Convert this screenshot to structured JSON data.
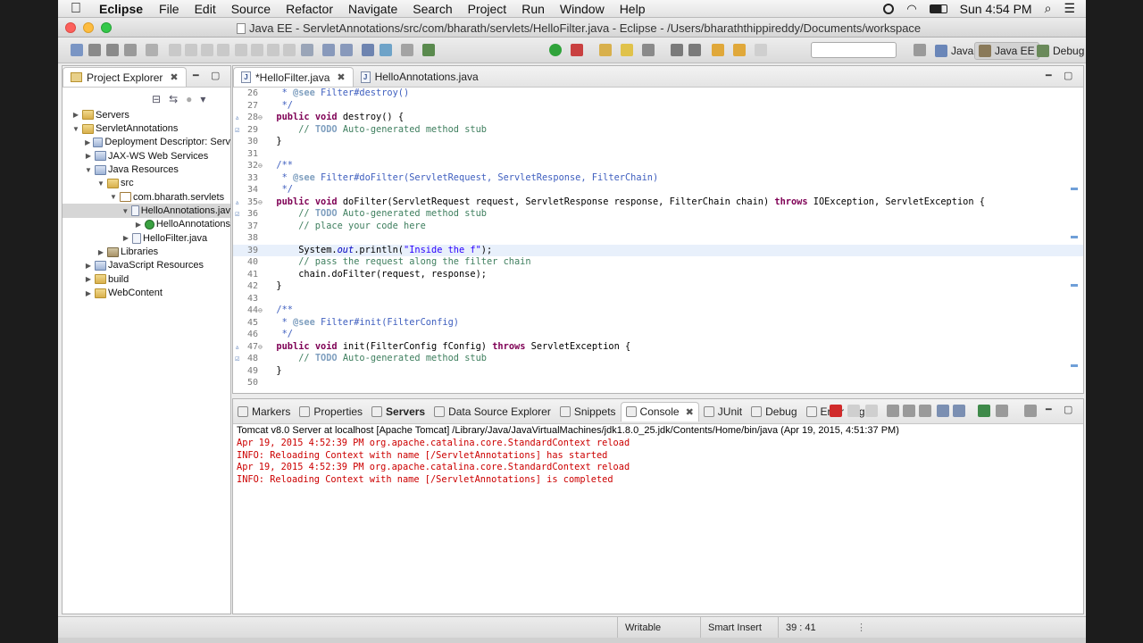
{
  "menubar": {
    "app_name": "Eclipse",
    "items": [
      "File",
      "Edit",
      "Source",
      "Refactor",
      "Navigate",
      "Search",
      "Project",
      "Run",
      "Window",
      "Help"
    ],
    "clock": "Sun 4:54 PM"
  },
  "window": {
    "title": "Java EE - ServletAnnotations/src/com/bharath/servlets/HelloFilter.java - Eclipse - /Users/bharaththippireddy/Documents/workspace"
  },
  "toolbar": {
    "quick_access_placeholder": "",
    "perspectives": [
      {
        "label": "Java",
        "icon": "java-perspective-icon"
      },
      {
        "label": "Java EE",
        "icon": "javaee-perspective-icon"
      },
      {
        "label": "Debug",
        "icon": "debug-perspective-icon"
      }
    ]
  },
  "explorer": {
    "tab_label": "Project Explorer",
    "tree": [
      {
        "label": "Servers",
        "indent": 0,
        "icon": "folder",
        "expanded": false
      },
      {
        "label": "ServletAnnotations",
        "indent": 0,
        "icon": "project",
        "expanded": true
      },
      {
        "label": "Deployment Descriptor: Serv",
        "indent": 1,
        "icon": "gen",
        "expanded": false
      },
      {
        "label": "JAX-WS Web Services",
        "indent": 1,
        "icon": "gen",
        "expanded": false
      },
      {
        "label": "Java Resources",
        "indent": 1,
        "icon": "gen",
        "expanded": true
      },
      {
        "label": "src",
        "indent": 2,
        "icon": "folder",
        "expanded": true
      },
      {
        "label": "com.bharath.servlets",
        "indent": 3,
        "icon": "pkg",
        "expanded": true
      },
      {
        "label": "HelloAnnotations.jav",
        "indent": 4,
        "icon": "java",
        "expanded": true,
        "selected": true
      },
      {
        "label": "HelloAnnotations",
        "indent": 5,
        "icon": "class",
        "expanded": false
      },
      {
        "label": "HelloFilter.java",
        "indent": 4,
        "icon": "java",
        "expanded": false
      },
      {
        "label": "Libraries",
        "indent": 2,
        "icon": "lib",
        "expanded": false
      },
      {
        "label": "JavaScript Resources",
        "indent": 1,
        "icon": "gen",
        "expanded": false
      },
      {
        "label": "build",
        "indent": 1,
        "icon": "folder",
        "expanded": false
      },
      {
        "label": "WebContent",
        "indent": 1,
        "icon": "folder",
        "expanded": false
      }
    ]
  },
  "editor": {
    "tabs": [
      {
        "label": "*HelloFilter.java",
        "active": true
      },
      {
        "label": "HelloAnnotations.java",
        "active": false
      }
    ],
    "lines": [
      {
        "n": "26",
        "text": "   * @see Filter#destroy()",
        "k": "jd"
      },
      {
        "n": "27",
        "text": "   */",
        "k": "jd"
      },
      {
        "n": "28",
        "text": "  public void destroy() {",
        "k": "code",
        "fold": "⊖",
        "mark": "▵"
      },
      {
        "n": "29",
        "text": "      // TODO Auto-generated method stub",
        "k": "cm",
        "mark": "☑"
      },
      {
        "n": "30",
        "text": "  }",
        "k": "code"
      },
      {
        "n": "31",
        "text": "",
        "k": "code"
      },
      {
        "n": "32",
        "text": "  /**",
        "k": "jd",
        "fold": "⊖"
      },
      {
        "n": "33",
        "text": "   * @see Filter#doFilter(ServletRequest, ServletResponse, FilterChain)",
        "k": "jd"
      },
      {
        "n": "34",
        "text": "   */",
        "k": "jd"
      },
      {
        "n": "35",
        "text": "  public void doFilter(ServletRequest request, ServletResponse response, FilterChain chain) throws IOException, ServletException {",
        "k": "code",
        "fold": "⊖",
        "mark": "▵"
      },
      {
        "n": "36",
        "text": "      // TODO Auto-generated method stub",
        "k": "cm",
        "mark": "☑"
      },
      {
        "n": "37",
        "text": "      // place your code here",
        "k": "cm"
      },
      {
        "n": "38",
        "text": "",
        "k": "code"
      },
      {
        "n": "39",
        "text": "      System.out.println(\"Inside the f\");",
        "k": "code",
        "current": true
      },
      {
        "n": "40",
        "text": "      // pass the request along the filter chain",
        "k": "cm"
      },
      {
        "n": "41",
        "text": "      chain.doFilter(request, response);",
        "k": "code"
      },
      {
        "n": "42",
        "text": "  }",
        "k": "code"
      },
      {
        "n": "43",
        "text": "",
        "k": "code"
      },
      {
        "n": "44",
        "text": "  /**",
        "k": "jd",
        "fold": "⊖"
      },
      {
        "n": "45",
        "text": "   * @see Filter#init(FilterConfig)",
        "k": "jd"
      },
      {
        "n": "46",
        "text": "   */",
        "k": "jd"
      },
      {
        "n": "47",
        "text": "  public void init(FilterConfig fConfig) throws ServletException {",
        "k": "code",
        "fold": "⊖",
        "mark": "▵"
      },
      {
        "n": "48",
        "text": "      // TODO Auto-generated method stub",
        "k": "cm",
        "mark": "☑"
      },
      {
        "n": "49",
        "text": "  }",
        "k": "code"
      },
      {
        "n": "50",
        "text": "",
        "k": "code"
      }
    ]
  },
  "console_panel": {
    "tabs": [
      {
        "label": "Markers",
        "icon": "markers-icon"
      },
      {
        "label": "Properties",
        "icon": "properties-icon"
      },
      {
        "label": "Servers",
        "icon": "servers-icon"
      },
      {
        "label": "Data Source Explorer",
        "icon": "data-source-icon"
      },
      {
        "label": "Snippets",
        "icon": "snippets-icon"
      },
      {
        "label": "Console",
        "icon": "console-icon",
        "active": true
      },
      {
        "label": "JUnit",
        "icon": "junit-icon"
      },
      {
        "label": "Debug",
        "icon": "debug-icon"
      },
      {
        "label": "Error Log",
        "icon": "error-log-icon"
      }
    ],
    "header": "Tomcat v8.0 Server at localhost [Apache Tomcat] /Library/Java/JavaVirtualMachines/jdk1.8.0_25.jdk/Contents/Home/bin/java (Apr 19, 2015, 4:51:37 PM)",
    "lines": [
      "Apr 19, 2015 4:52:39 PM org.apache.catalina.core.StandardContext reload",
      "INFO: Reloading Context with name [/ServletAnnotations] has started",
      "Apr 19, 2015 4:52:39 PM org.apache.catalina.core.StandardContext reload",
      "INFO: Reloading Context with name [/ServletAnnotations] is completed"
    ]
  },
  "status": {
    "writable": "Writable",
    "insert_mode": "Smart Insert",
    "position": "39 : 41"
  }
}
